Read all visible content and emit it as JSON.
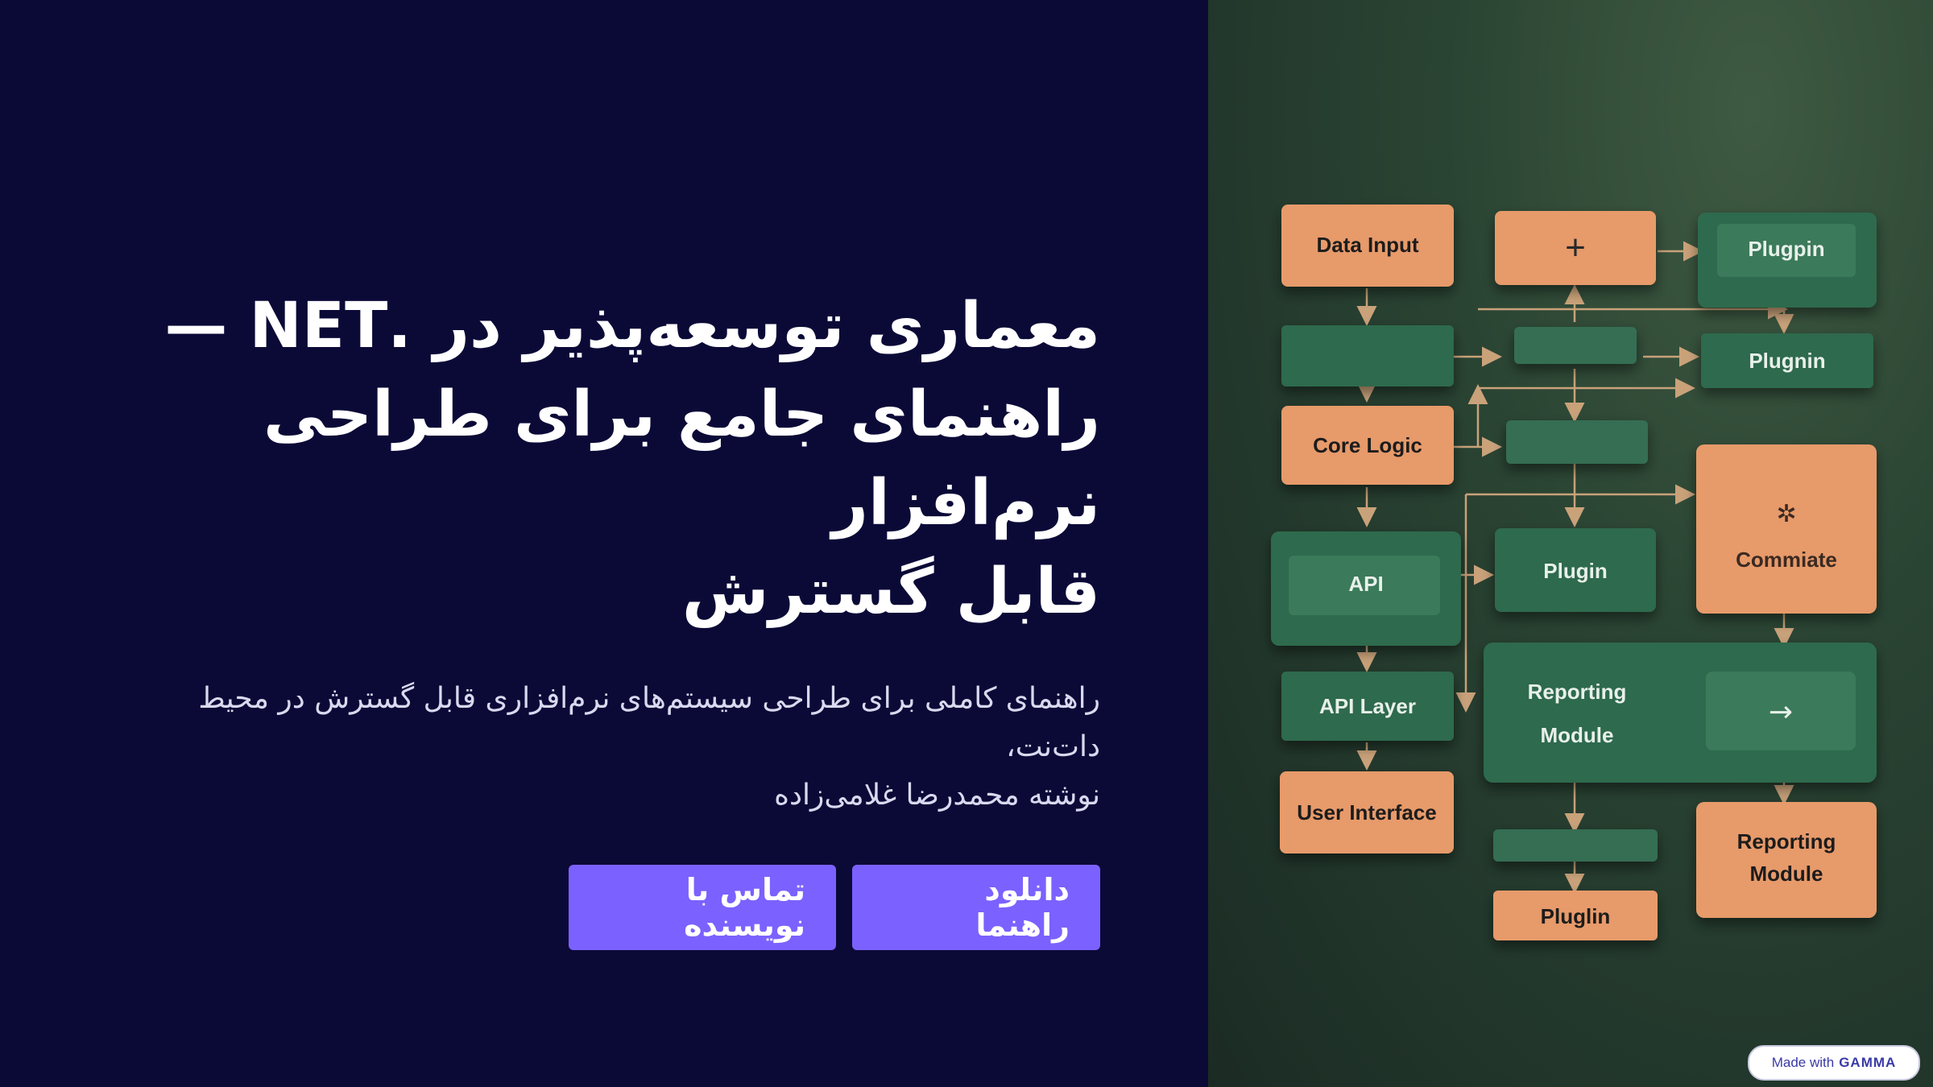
{
  "hero": {
    "title_line1": "معماری توسعه‌پذیر در .NET —",
    "title_line2": "راهنمای جامع برای طراحی نرم‌افزار",
    "title_line3": "قابل گسترش",
    "subtitle_line1": "راهنمای کاملی برای طراحی سیستم‌های نرم‌افزاری قابل گسترش در محیط دات‌نت،",
    "subtitle_line2": "نوشته محمدرضا غلامی‌زاده",
    "download_button": "دانلود راهنما",
    "contact_button": "تماس با نویسنده"
  },
  "diagram": {
    "data_input": "Data Input",
    "plus": "+",
    "plugpin": "Plugpin",
    "plugnin": "Plugnin",
    "core_logic": "Core Logic",
    "api": "API",
    "plugin": "Plugin",
    "commiate": "Commiate",
    "api_layer": "API Layer",
    "reporting_module_line1": "Reporting",
    "reporting_module_line2": "Module",
    "arrow": "→",
    "user_interface": "User Interface",
    "reporting_module2_line1": "Reporting",
    "reporting_module2_line2": "Module",
    "pluglin": "Pluglin"
  },
  "badge": {
    "made_with": "Made with",
    "brand": "GAMMA"
  },
  "colors": {
    "background": "#0b0a37",
    "accent": "#7b61ff",
    "orange_node": "#e79a6b",
    "green_node": "#2f6a4d"
  }
}
